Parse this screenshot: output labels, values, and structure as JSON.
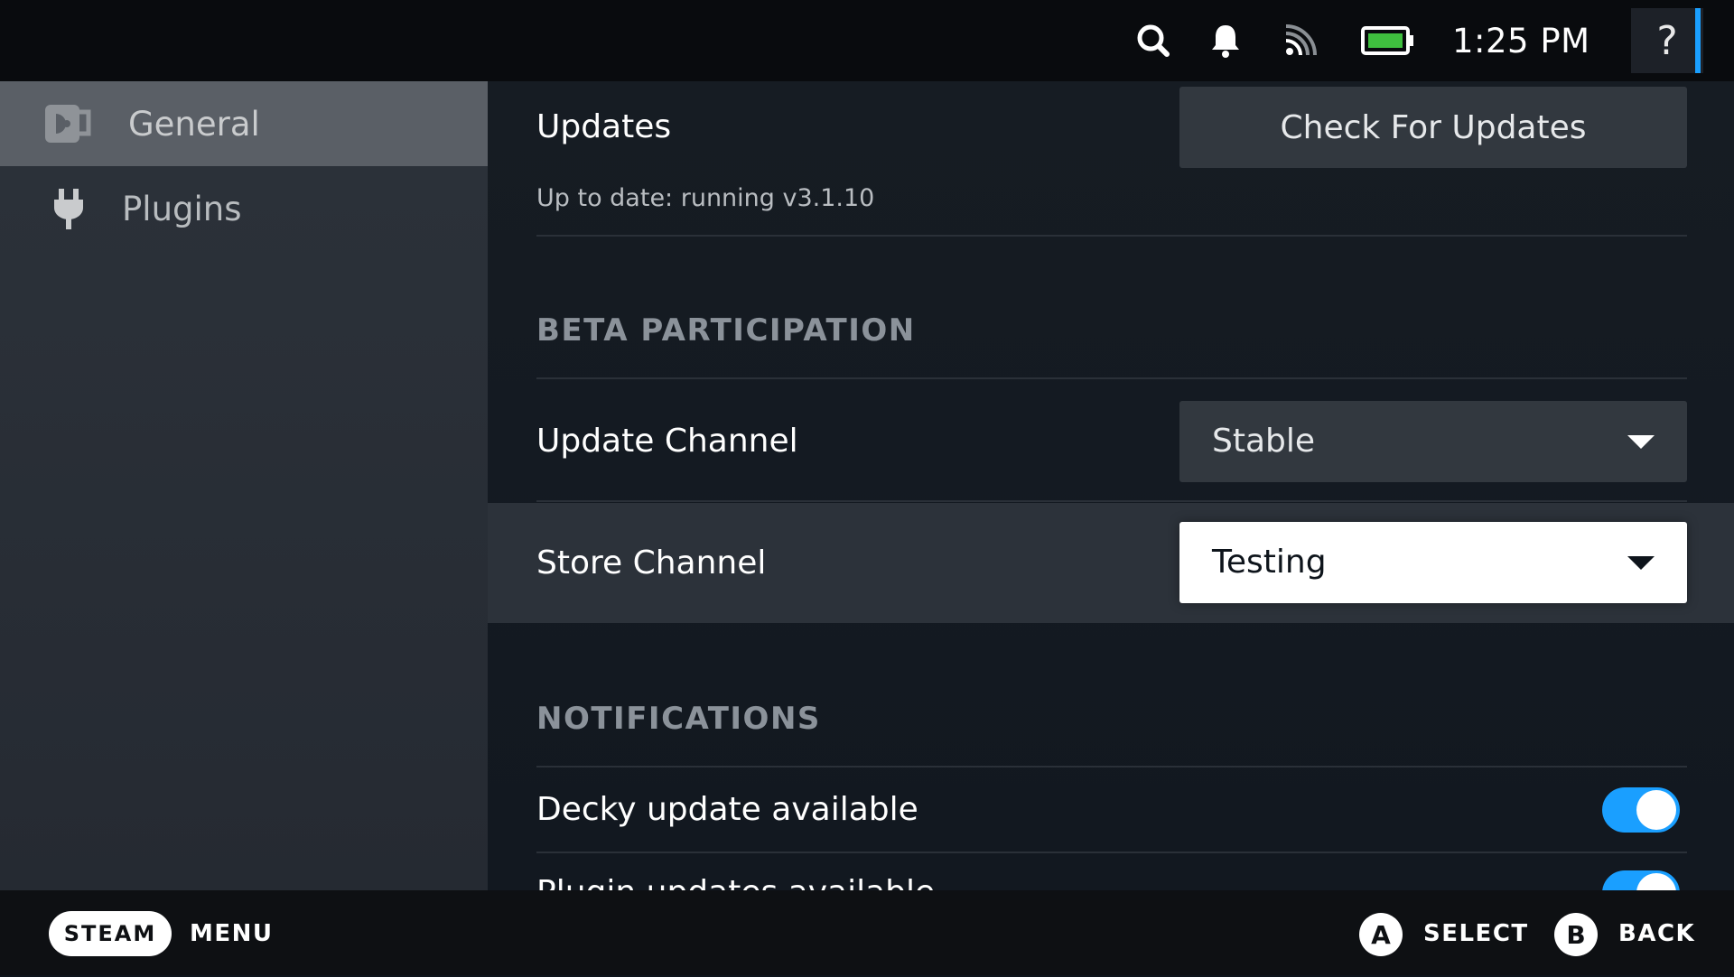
{
  "topbar": {
    "icons": [
      "search-icon",
      "notifications-bell-icon",
      "network-signal-icon",
      "battery-icon"
    ],
    "clock": "1:25 PM",
    "help_label": "?",
    "battery_color": "#3fbf3f",
    "accent_color": "#1a9fff"
  },
  "sidebar": {
    "items": [
      {
        "label": "General",
        "icon": "decky-logo-icon",
        "active": true
      },
      {
        "label": "Plugins",
        "icon": "plug-icon",
        "active": false
      }
    ]
  },
  "main": {
    "updates": {
      "label": "Updates",
      "button": "Check For Updates",
      "status": "Up to date: running v3.1.10"
    },
    "beta": {
      "title": "BETA PARTICIPATION",
      "update_channel": {
        "label": "Update Channel",
        "value": "Stable"
      },
      "store_channel": {
        "label": "Store Channel",
        "value": "Testing"
      }
    },
    "notifications": {
      "title": "NOTIFICATIONS",
      "decky_update": {
        "label": "Decky update available",
        "enabled": true
      },
      "plugin_update": {
        "label": "Plugin updates available",
        "enabled": true
      }
    }
  },
  "bottombar": {
    "steam": "STEAM",
    "menu": "MENU",
    "a_button": "A",
    "select": "SELECT",
    "b_button": "B",
    "back": "BACK"
  }
}
